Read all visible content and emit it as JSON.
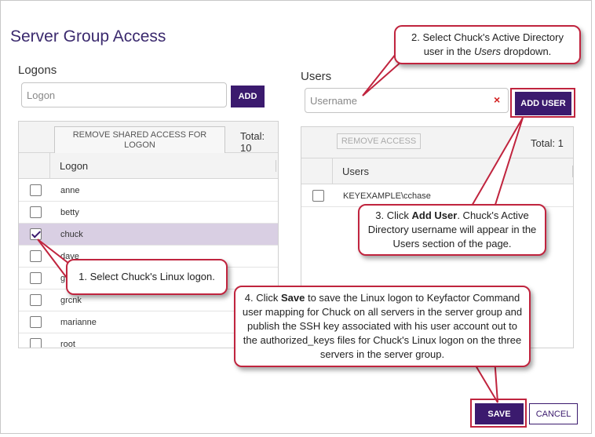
{
  "dialog": {
    "title": "Server Group Access"
  },
  "logons": {
    "label": "Logons",
    "input_placeholder": "Logon",
    "add_label": "ADD",
    "remove_label": "REMOVE SHARED ACCESS FOR LOGON",
    "total_label": "Total: 10",
    "column_header": "Logon",
    "rows": [
      {
        "name": "anne",
        "checked": false
      },
      {
        "name": "betty",
        "checked": false
      },
      {
        "name": "chuck",
        "checked": true
      },
      {
        "name": "dave",
        "checked": false
      },
      {
        "name": "g",
        "checked": false
      },
      {
        "name": "grcnk",
        "checked": false
      },
      {
        "name": "marianne",
        "checked": false
      },
      {
        "name": "root",
        "checked": false
      }
    ]
  },
  "users": {
    "label": "Users",
    "input_placeholder": "Username",
    "clear_glyph": "×",
    "add_label": "ADD USER",
    "remove_label": "REMOVE ACCESS",
    "total_label": "Total: 1",
    "column_header": "Users",
    "rows": [
      {
        "name": "KEYEXAMPLE\\cchase",
        "checked": false
      }
    ]
  },
  "footer": {
    "save_label": "SAVE",
    "cancel_label": "CANCEL"
  },
  "callouts": {
    "step1": "1. Select Chuck's Linux logon.",
    "step2_a": "2. Select Chuck's Active Directory",
    "step2_b": "user in the ",
    "step2_em": "Users",
    "step2_c": " dropdown.",
    "step3_a": "3. Click ",
    "step3_b": "Add User",
    "step3_c": ". Chuck's Active Directory username will appear in the Users section of the page.",
    "step4_a": "4. Click ",
    "step4_b": "Save",
    "step4_c": " to save the Linux logon to Keyfactor Command user mapping for Chuck on all servers in the server group and publish the SSH key associated with his user account out to the authorized_keys files for Chuck's Linux logon on the three servers in the server group."
  },
  "colors": {
    "brand": "#3b1a6e",
    "title": "#3b2a6e",
    "callout_border": "#c0243e",
    "selected_row": "#d9cfe3"
  }
}
